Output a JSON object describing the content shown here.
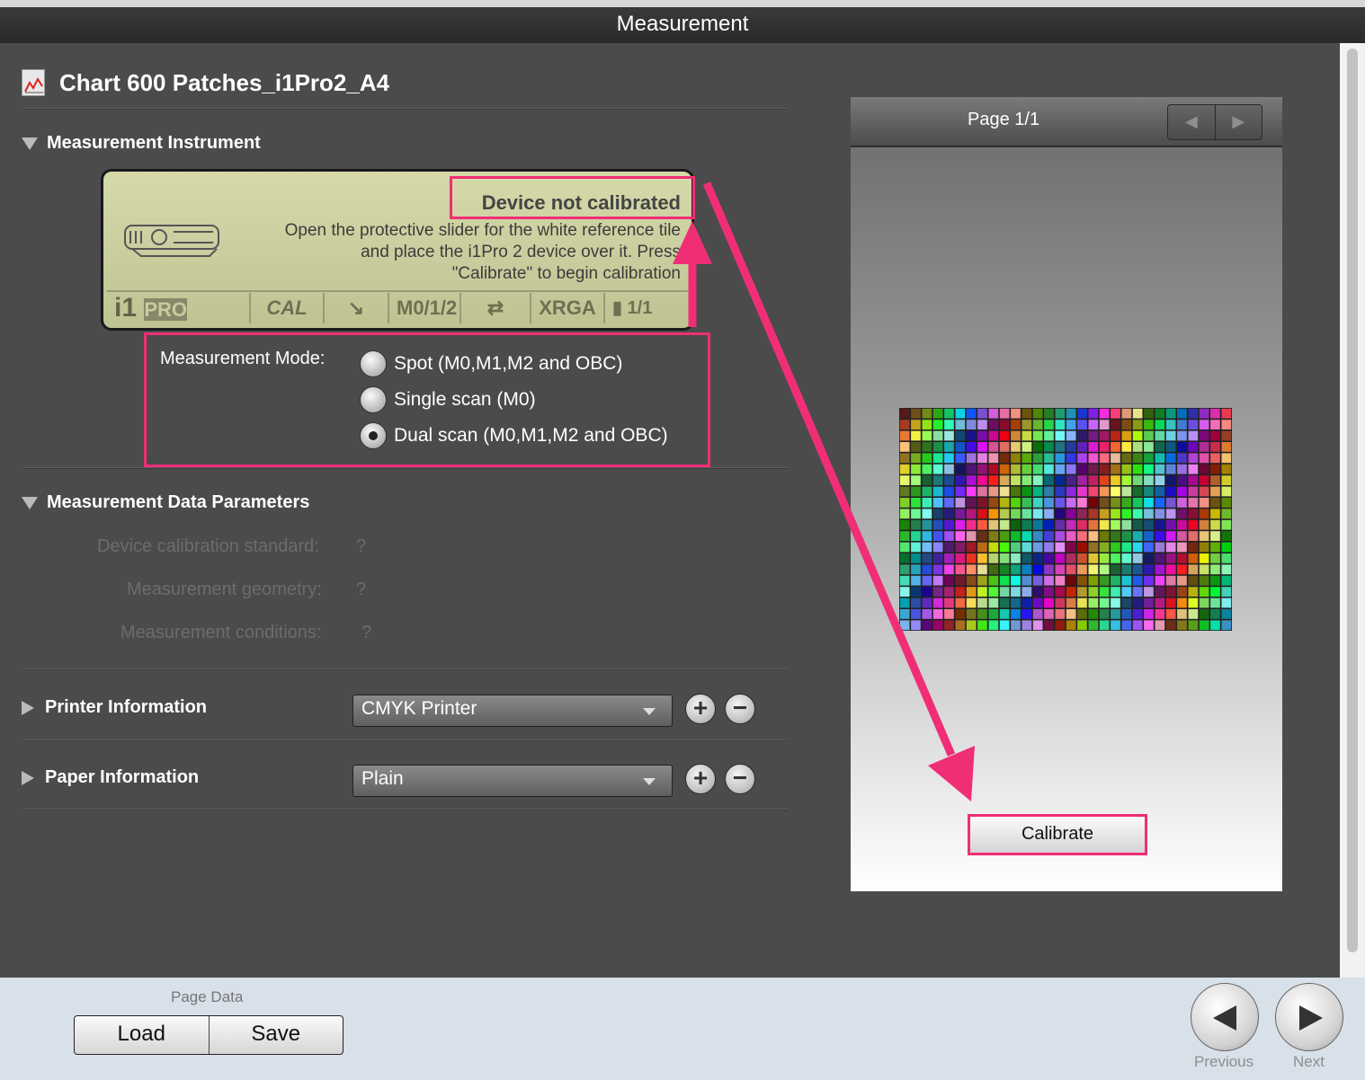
{
  "window": {
    "title": "Measurement"
  },
  "chart": {
    "title": "Chart 600 Patches_i1Pro2_A4"
  },
  "instrument": {
    "section_label": "Measurement Instrument",
    "status": "Device not calibrated",
    "message_lines": [
      "Open the protective slider for the white reference tile",
      "and place the i1Pro 2 device over it. Press",
      "\"Calibrate\" to begin calibration"
    ],
    "bar": {
      "brand": "i1",
      "model": "PRO",
      "cal": "CAL",
      "modes": "M0/1/2",
      "xrga": "XRGA",
      "pages": "1/1"
    },
    "mode_label": "Measurement Mode:",
    "modes": [
      {
        "label": "Spot (M0,M1,M2 and OBC)",
        "selected": false
      },
      {
        "label": "Single scan (M0)",
        "selected": false
      },
      {
        "label": "Dual scan (M0,M1,M2 and OBC)",
        "selected": true
      }
    ]
  },
  "data_params": {
    "section_label": "Measurement Data Parameters",
    "calibration_standard": {
      "label": "Device calibration standard:",
      "value": "?"
    },
    "geometry": {
      "label": "Measurement geometry:",
      "value": "?"
    },
    "conditions": {
      "label": "Measurement conditions:",
      "value": "?"
    }
  },
  "printer": {
    "section_label": "Printer Information",
    "selected": "CMYK Printer",
    "add": "+",
    "remove": "−"
  },
  "paper": {
    "section_label": "Paper Information",
    "selected": "Plain",
    "add": "+",
    "remove": "−"
  },
  "preview": {
    "page_label": "Page 1/1",
    "prev_glyph": "◀",
    "next_glyph": "▶",
    "calibrate_label": "Calibrate",
    "patch_grid": {
      "columns": 30,
      "rows": 20
    }
  },
  "footer": {
    "page_data_label": "Page Data",
    "load_label": "Load",
    "save_label": "Save",
    "previous_label": "Previous",
    "next_label": "Next"
  },
  "colors": {
    "annotation": "#f02e76",
    "background": "#4b4b4b",
    "lcd": "#cfd2a2"
  }
}
